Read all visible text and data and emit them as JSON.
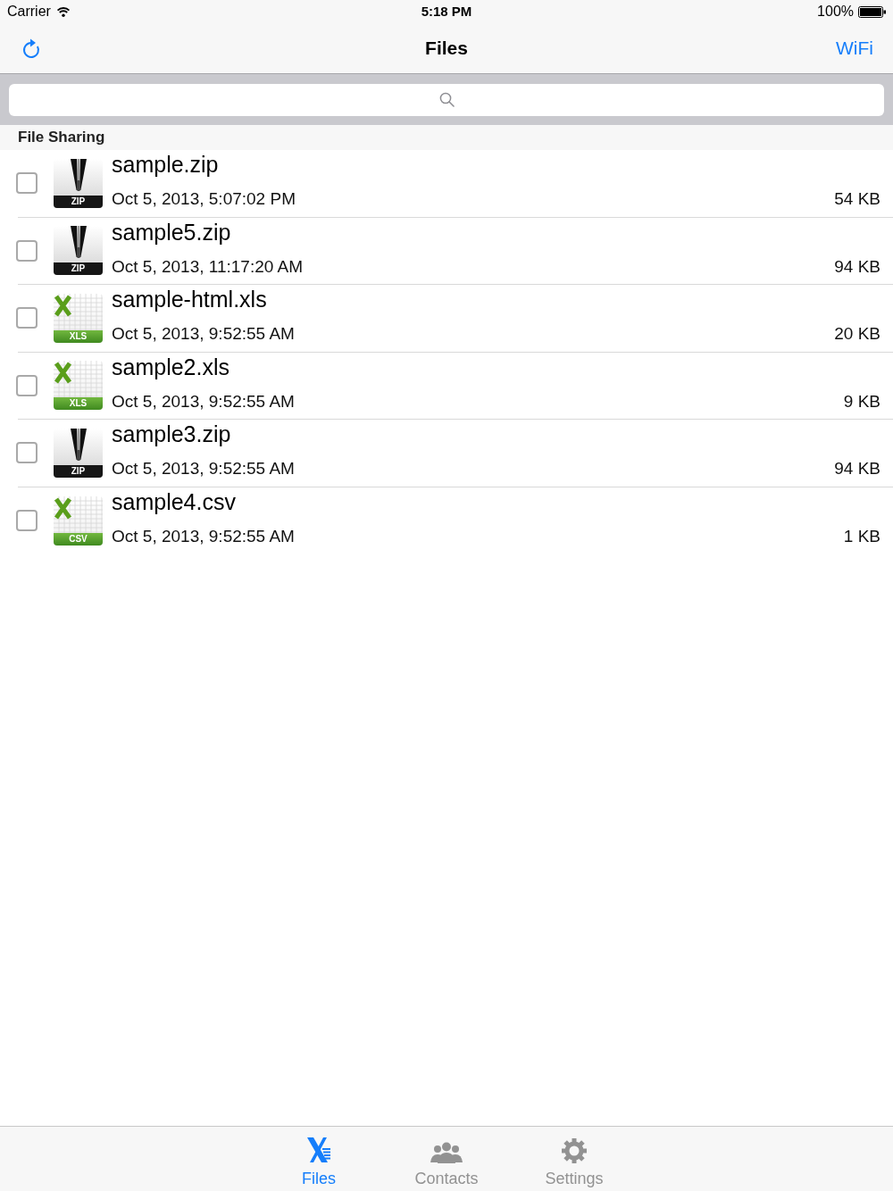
{
  "status_bar": {
    "carrier": "Carrier",
    "time": "5:18 PM",
    "battery": "100%"
  },
  "nav_bar": {
    "title": "Files",
    "right_button": "WiFi"
  },
  "section": {
    "title": "File Sharing"
  },
  "files": [
    {
      "kind": "zip",
      "badge": "ZIP",
      "name": "sample.zip",
      "date": "Oct 5, 2013, 5:07:02 PM",
      "size": "54 KB",
      "checked": false
    },
    {
      "kind": "zip",
      "badge": "ZIP",
      "name": "sample5.zip",
      "date": "Oct 5, 2013, 11:17:20 AM",
      "size": "94 KB",
      "checked": false
    },
    {
      "kind": "spreadsheet",
      "badge": "XLS",
      "name": "sample-html.xls",
      "date": "Oct 5, 2013, 9:52:55 AM",
      "size": "20 KB",
      "checked": false
    },
    {
      "kind": "spreadsheet",
      "badge": "XLS",
      "name": "sample2.xls",
      "date": "Oct 5, 2013, 9:52:55 AM",
      "size": "9 KB",
      "checked": false
    },
    {
      "kind": "zip",
      "badge": "ZIP",
      "name": "sample3.zip",
      "date": "Oct 5, 2013, 9:52:55 AM",
      "size": "94 KB",
      "checked": false
    },
    {
      "kind": "spreadsheet",
      "badge": "CSV",
      "name": "sample4.csv",
      "date": "Oct 5, 2013, 9:52:55 AM",
      "size": "1 KB",
      "checked": false
    }
  ],
  "tabs": [
    {
      "label": "Files",
      "selected": true
    },
    {
      "label": "Contacts",
      "selected": false
    },
    {
      "label": "Settings",
      "selected": false
    }
  ]
}
